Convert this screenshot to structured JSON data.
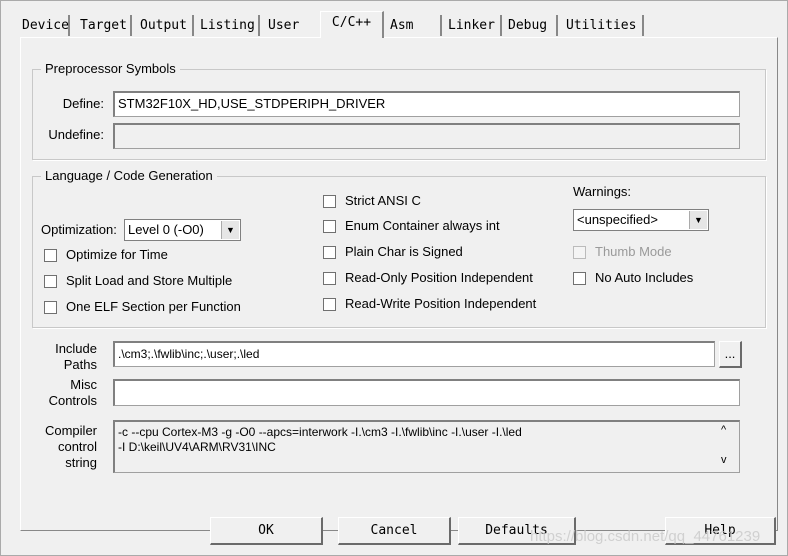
{
  "tabs": [
    "Device",
    "Target",
    "Output",
    "Listing",
    "User",
    "C/C++",
    "Asm",
    "Linker",
    "Debug",
    "Utilities"
  ],
  "active_tab": "C/C++",
  "preprocessor": {
    "title": "Preprocessor Symbols",
    "define_label": "Define:",
    "define_value": "STM32F10X_HD,USE_STDPERIPH_DRIVER",
    "undefine_label": "Undefine:",
    "undefine_value": ""
  },
  "language": {
    "title": "Language / Code Generation",
    "optimization_label": "Optimization:",
    "optimization_value": "Level 0 (-O0)",
    "left_checks": [
      {
        "label": "Optimize for Time",
        "checked": false
      },
      {
        "label": "Split Load and Store Multiple",
        "checked": false
      },
      {
        "label": "One ELF Section per Function",
        "checked": false
      }
    ],
    "mid_checks": [
      {
        "label": "Strict ANSI C",
        "checked": false
      },
      {
        "label": "Enum Container always int",
        "checked": false
      },
      {
        "label": "Plain Char is Signed",
        "checked": false
      },
      {
        "label": "Read-Only Position Independent",
        "checked": false
      },
      {
        "label": "Read-Write Position Independent",
        "checked": false
      }
    ],
    "warnings_label": "Warnings:",
    "warnings_value": "<unspecified>",
    "thumb_mode": {
      "label": "Thumb Mode",
      "checked": false,
      "disabled": true
    },
    "no_auto_includes": {
      "label": "No Auto Includes",
      "checked": false
    }
  },
  "include": {
    "label1": "Include",
    "label2": "Paths",
    "value": ".\\cm3;.\\fwlib\\inc;.\\user;.\\led",
    "browse": "..."
  },
  "misc": {
    "label1": "Misc",
    "label2": "Controls",
    "value": ""
  },
  "compiler": {
    "label1": "Compiler",
    "label2": "control",
    "label3": "string",
    "line1": "-c --cpu Cortex-M3 -g -O0 --apcs=interwork -I.\\cm3 -I.\\fwlib\\inc -I.\\user -I.\\led",
    "line2": "-I D:\\keil\\UV4\\ARM\\RV31\\INC"
  },
  "buttons": {
    "ok": "OK",
    "cancel": "Cancel",
    "defaults": "Defaults",
    "help": "Help"
  },
  "watermark": "https://blog.csdn.net/qq_44761239"
}
